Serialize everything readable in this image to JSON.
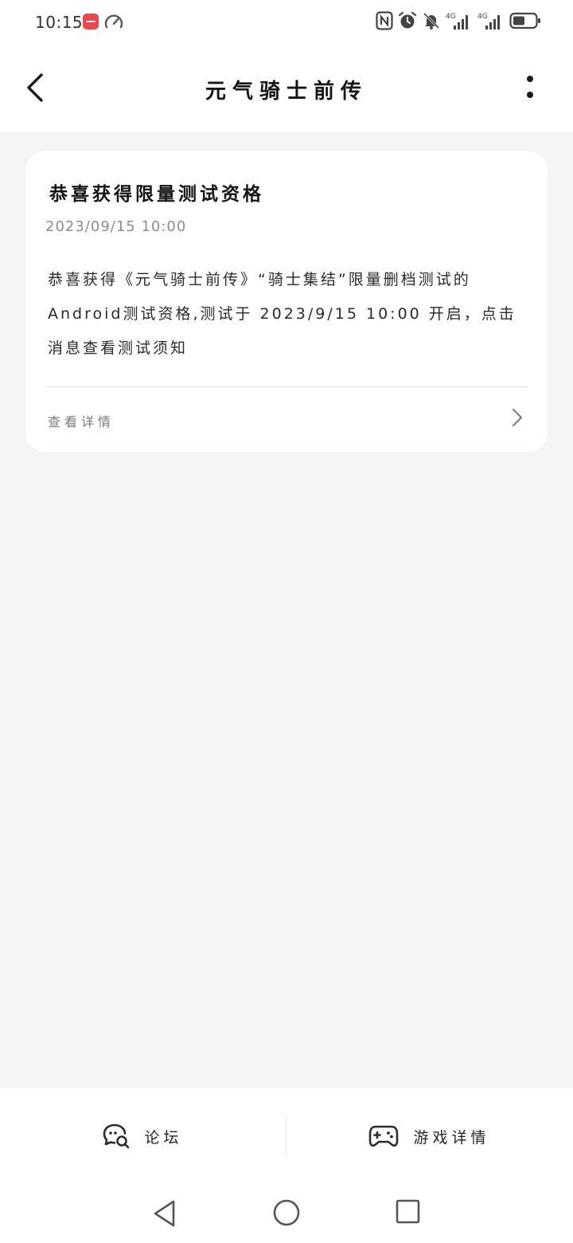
{
  "status_bar": {
    "time": "10:15",
    "icons": [
      "app-notification-icon",
      "speed-icon",
      "nfc-icon",
      "alarm-icon",
      "mute-icon",
      "signal-4g-icon",
      "signal-4g-icon",
      "battery-icon"
    ]
  },
  "header": {
    "title": "元气骑士前传",
    "back_icon": "chevron-left-icon",
    "more_icon": "more-vertical-icon"
  },
  "message": {
    "title": "恭喜获得限量测试资格",
    "time": "2023/09/15 10:00",
    "body": "恭喜获得《元气骑士前传》“骑士集结”限量删档测试的Android测试资格,测试于 2023/9/15 10:00 开启，点击消息查看测试须知",
    "link_label": "查看详情"
  },
  "bottom_bar": {
    "forum_label": "论坛",
    "game_detail_label": "游戏详情"
  },
  "colors": {
    "background": "#f4f5f7",
    "card": "#ffffff",
    "text_primary": "#1b1b1b",
    "text_secondary": "#8a8d93"
  }
}
